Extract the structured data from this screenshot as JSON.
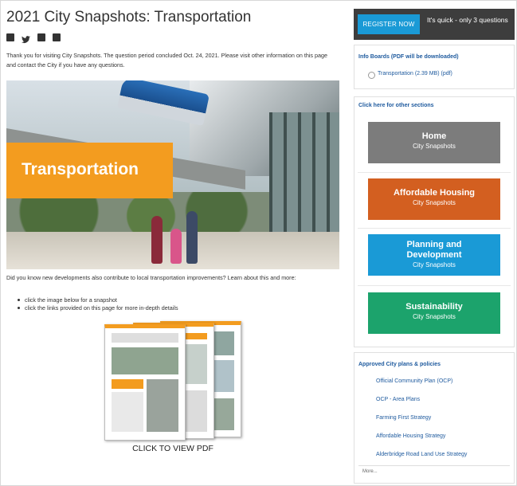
{
  "page": {
    "title": "2021 City Snapshots: Transportation",
    "intro": "Thank you for visiting City Snapshots. The question period concluded Oct. 24, 2021. Please visit other information on this page and contact the City if you have any questions.",
    "hero_banner": "Transportation",
    "know_text": "Did you know new developments also contribute to local transportation improvements? Learn about this and more:",
    "bullets": [
      "click the image below for a snapshot",
      "click the links provided on this page for more in-depth details"
    ],
    "pdf_caption": "CLICK TO VIEW PDF"
  },
  "share_icons": [
    "facebook-icon",
    "twitter-icon",
    "linkedin-icon",
    "email-icon"
  ],
  "register": {
    "button": "REGISTER NOW",
    "text": "It's quick - only 3 questions"
  },
  "info_boards": {
    "heading": "Info Boards (PDF will be downloaded)",
    "item": "Transportation (2.39 MB) (pdf)"
  },
  "sections": {
    "heading": "Click here for other sections",
    "tiles": [
      {
        "title": "Home",
        "subtitle": "City Snapshots",
        "color": "#7c7c7c"
      },
      {
        "title": "Affordable Housing",
        "subtitle": "City Snapshots",
        "color": "#d35f20"
      },
      {
        "title": "Planning and Development",
        "subtitle": "City Snapshots",
        "color": "#1a9ad6"
      },
      {
        "title": "Sustainability",
        "subtitle": "City Snapshots",
        "color": "#1ca36c"
      }
    ]
  },
  "plans": {
    "heading": "Approved City plans & policies",
    "items": [
      "Official Community Plan (OCP)",
      "OCP - Area Plans",
      "Farming First Strategy",
      "Affordable Housing Strategy",
      "Alderbridge Road Land Use Strategy"
    ],
    "more": "More..."
  },
  "colors": {
    "accent": "#f39c1f",
    "link": "#1e5a9e",
    "register_bg": "#3d3d3d",
    "register_btn": "#1a9ad6"
  }
}
